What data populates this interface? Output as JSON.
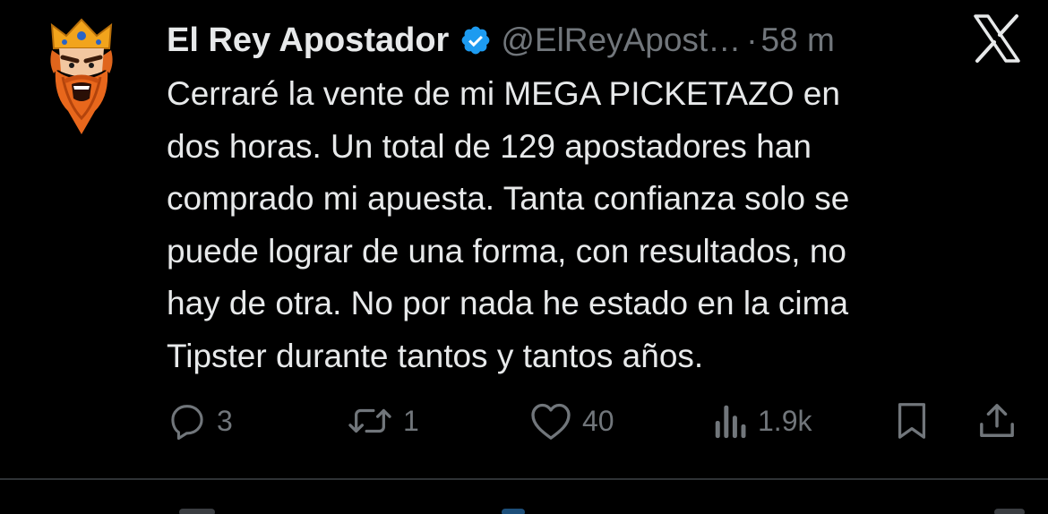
{
  "colors": {
    "background": "#000000",
    "text_primary": "#e7e9ea",
    "text_secondary": "#71767b",
    "verified_blue": "#1d9bf0",
    "divider": "#2f3336"
  },
  "tweet": {
    "author": {
      "display_name": "El Rey Apostador",
      "handle": "@ElReyApost…",
      "verified": true,
      "avatar_icon": "king-avatar-icon"
    },
    "separator": "·",
    "time": "58 m",
    "platform_icon": "x-logo-icon",
    "text": "Cerraré la vente de mi MEGA PICKETAZO en\ndos horas. Un total de 129 apostadores han\ncomprado mi apuesta. Tanta confianza solo se\npuede lograr de una forma, con resultados, no\nhay de otra. No por nada he estado en la cima\nTipster durante tantos y tantos años.",
    "actions": {
      "reply": {
        "icon": "reply-icon",
        "count": "3"
      },
      "retweet": {
        "icon": "retweet-icon",
        "count": "1"
      },
      "like": {
        "icon": "heart-icon",
        "count": "40"
      },
      "views": {
        "icon": "views-icon",
        "count": "1.9k"
      },
      "bookmark": {
        "icon": "bookmark-icon"
      },
      "share": {
        "icon": "share-icon"
      }
    }
  }
}
